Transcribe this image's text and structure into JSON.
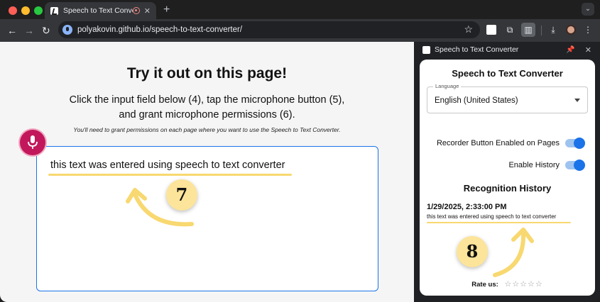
{
  "browser": {
    "tab_title": "Speech to Text Converter",
    "url": "polyakovin.github.io/speech-to-text-converter/"
  },
  "page": {
    "heading": "Try it out on this page!",
    "instructions_line1": "Click the input field below (4), tap the microphone button (5),",
    "instructions_line2": "and grant microphone permissions (6).",
    "note": "You'll need to grant permissions on each page where you want to use the Speech to Text Converter.",
    "input_text": "this text was entered using speech to text converter",
    "badge_7": "7"
  },
  "side_panel": {
    "header_title": "Speech to Text Converter",
    "card_title": "Speech to Text Converter",
    "language_label": "Language",
    "language_value": "English (United States)",
    "recorder_label": "Recorder Button Enabled on Pages",
    "recorder_enabled": true,
    "history_label": "Enable History",
    "history_enabled": true,
    "history_title": "Recognition History",
    "history_entry_time": "1/29/2025, 2:33:00 PM",
    "history_entry_text": "this text was entered using speech to text converter",
    "badge_8": "8",
    "rate_label": "Rate us:",
    "stars": "☆☆☆☆☆"
  },
  "colors": {
    "accent": "#1a73e8",
    "mic": "#c2185b",
    "highlight": "#f8d870",
    "badge": "#fce49a"
  }
}
